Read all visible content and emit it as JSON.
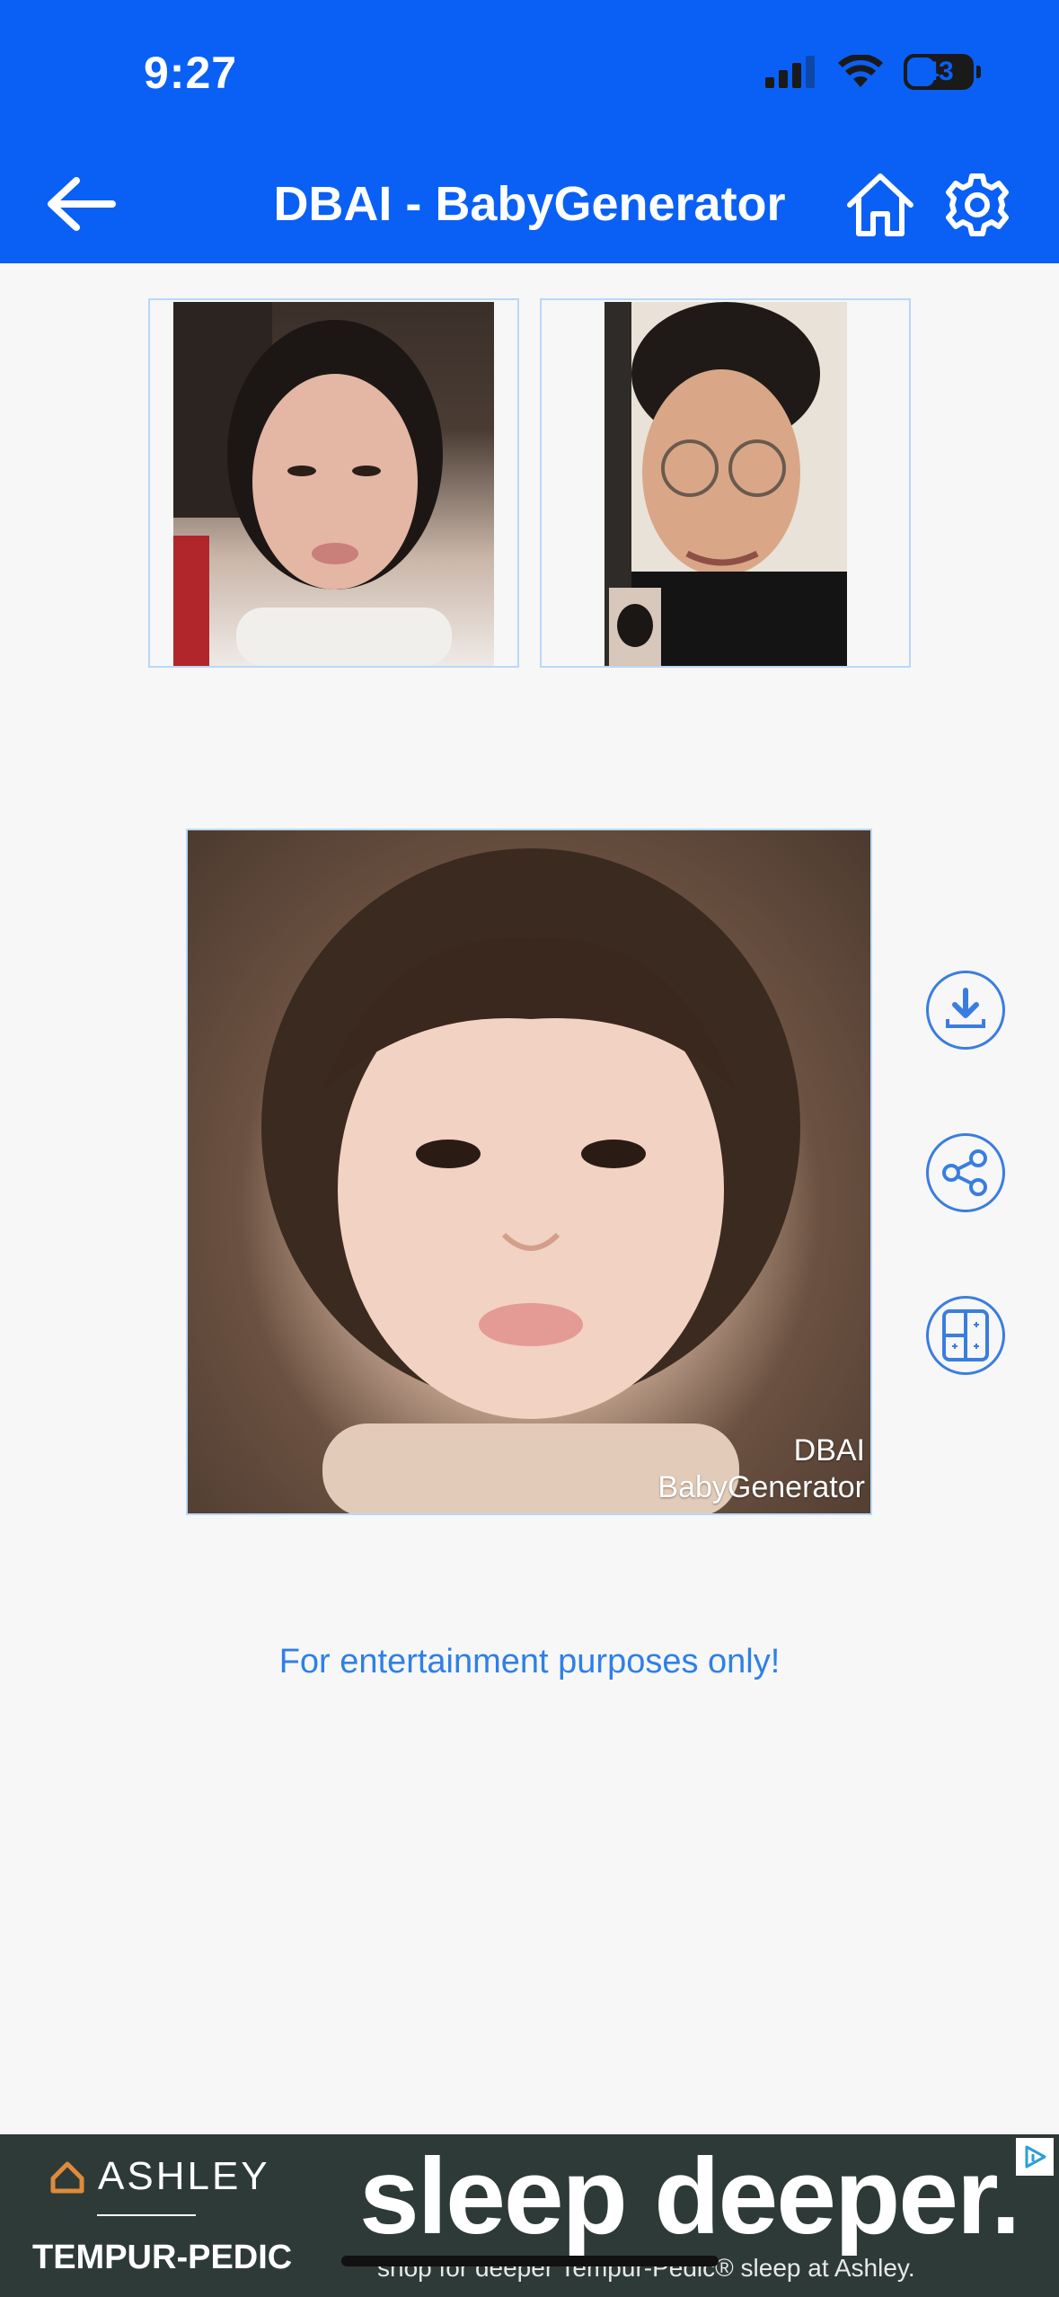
{
  "status_bar": {
    "time": "9:27",
    "battery": "43",
    "battery_level": 0.43
  },
  "header": {
    "title": "DBAI - BabyGenerator",
    "back_icon": "arrow-left-icon",
    "home_icon": "home-icon",
    "settings_icon": "gear-icon"
  },
  "parents": [
    {
      "label": "mother-photo"
    },
    {
      "label": "father-photo"
    }
  ],
  "result": {
    "watermark_line1": "DBAI",
    "watermark_line2": "BabyGenerator"
  },
  "actions": [
    {
      "icon": "download-icon"
    },
    {
      "icon": "share-icon"
    },
    {
      "icon": "compare-layout-icon"
    }
  ],
  "disclaimer": "For entertainment purposes only!",
  "ad": {
    "brand1": "ASHLEY",
    "brand2": "TEMPUR-PEDIC",
    "headline": "sleep deeper.",
    "subtext": "shop for deeper Tempur-Pedic® sleep at Ashley."
  },
  "colors": {
    "header_bg": "#0a60f5",
    "accent": "#2e80e6",
    "frame_border": "#b9d8f7",
    "ad_bg": "#2e3a37"
  }
}
